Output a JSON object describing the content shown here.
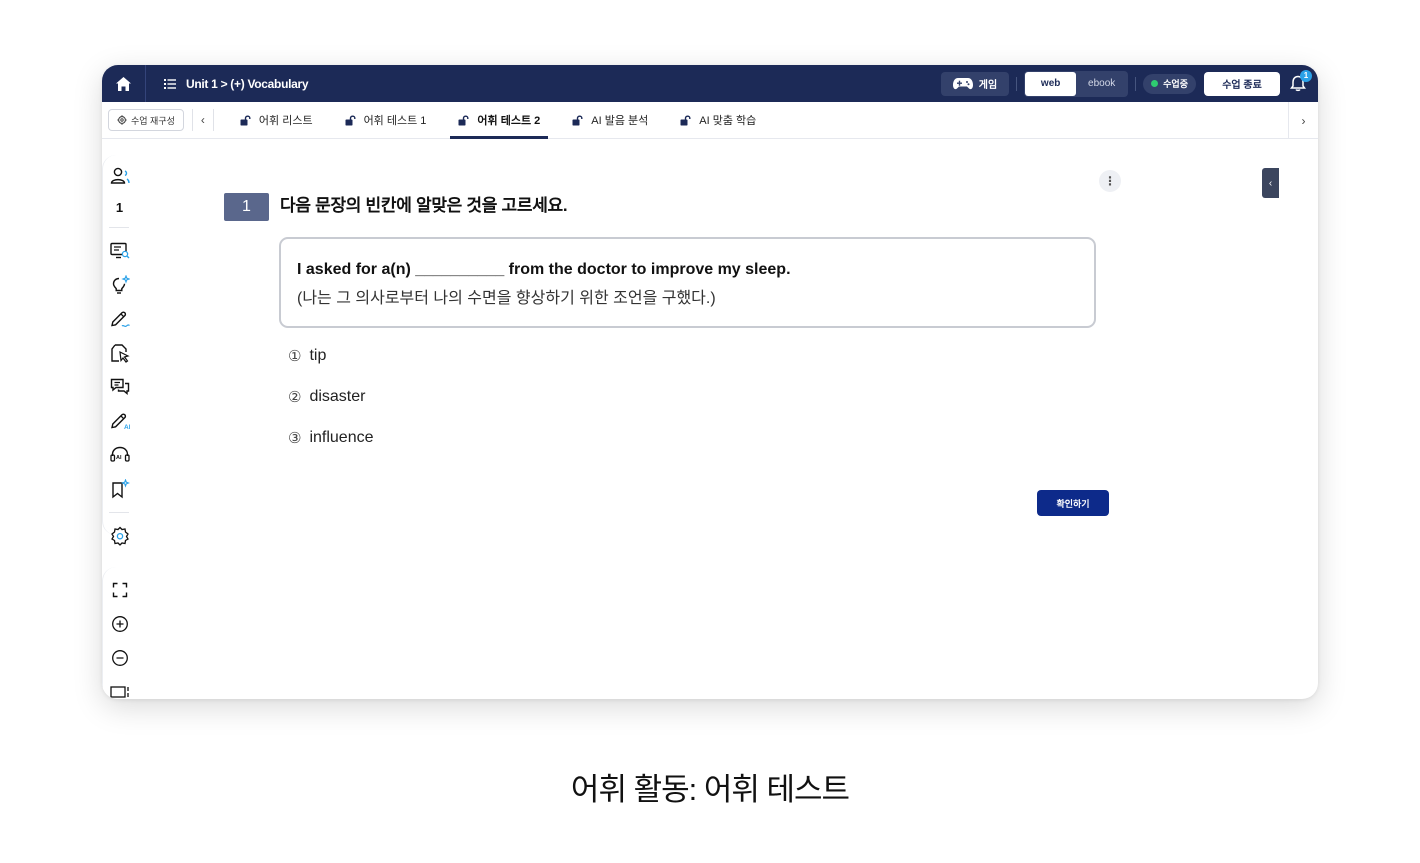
{
  "header": {
    "breadcrumb": "Unit 1 > (+) Vocabulary",
    "game_label": "게임",
    "view_modes": [
      "web",
      "ebook"
    ],
    "active_view": "web",
    "status_label": "수업중",
    "end_button": "수업 종료",
    "notification_count": "1"
  },
  "tabbar": {
    "reconfigure_label": "수업 재구성",
    "tabs": [
      {
        "label": "어휘 리스트"
      },
      {
        "label": "어휘 테스트 1"
      },
      {
        "label": "어휘 테스트 2"
      },
      {
        "label": "AI 발음 분석"
      },
      {
        "label": "AI 맞춤 학습"
      }
    ],
    "active_tab": "어휘 테스트 2"
  },
  "question": {
    "number": "1",
    "instruction": "다음 문장의 빈칸에 알맞은 것을 고르세요.",
    "sentence_en": "I asked for a(n) __________ from the doctor to improve my sleep.",
    "sentence_ko": "(나는 그 의사로부터 나의 수면을 향상하기 위한 조언을 구했다.)",
    "options": [
      {
        "mark": "①",
        "text": "tip"
      },
      {
        "mark": "②",
        "text": "disaster"
      },
      {
        "mark": "③",
        "text": "influence"
      }
    ],
    "confirm_label": "확인하기"
  },
  "sidebar": {
    "participant_count": "1"
  },
  "caption": "어휘 활동: 어휘 테스트",
  "colors": {
    "nav": "#1c2a57",
    "primary_button": "#0d2a8a",
    "question_badge": "#5a678c",
    "status_dot": "#2ecc71",
    "badge": "#2aa1e8"
  }
}
